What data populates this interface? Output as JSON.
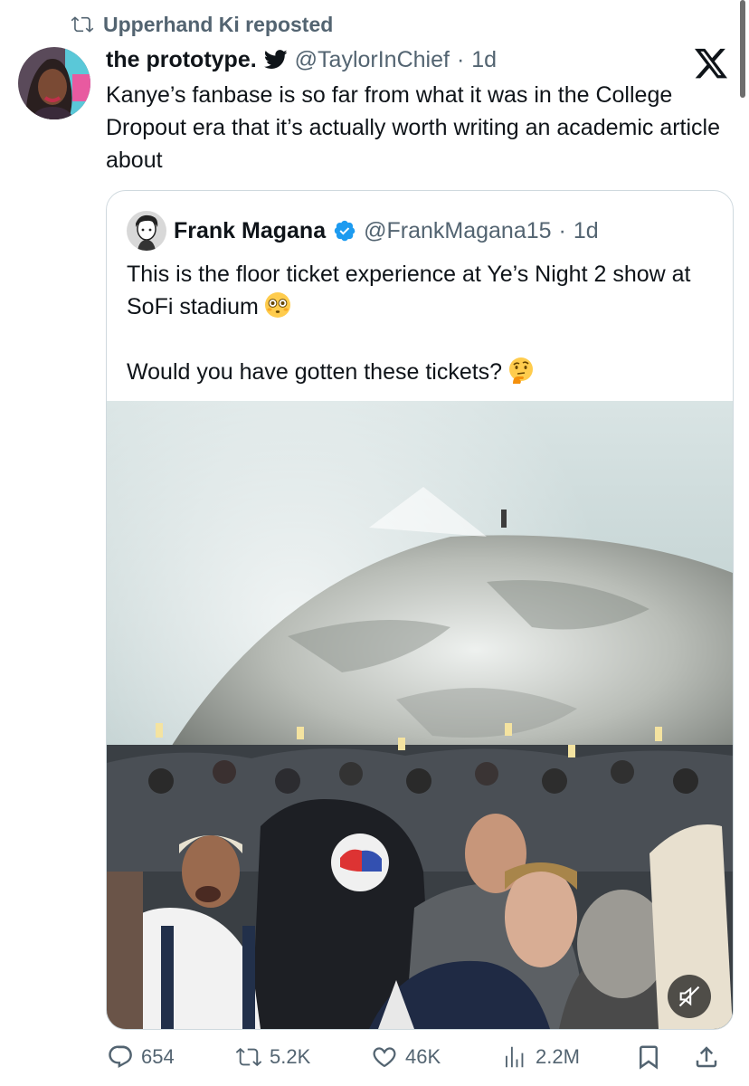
{
  "repost": {
    "icon": "repost-icon",
    "text": "Upperhand Ki reposted"
  },
  "tweet": {
    "display_name": "the prototype.",
    "handle": "@TaylorInChief",
    "separator": "·",
    "time": "1d",
    "text": "Kanye’s fanbase is so far from what it was in the College Dropout era that it’s actually worth writing an academic article about"
  },
  "quote": {
    "display_name": "Frank Magana",
    "handle": "@FrankMagana15",
    "separator": "·",
    "time": "1d",
    "line1": "This is the floor ticket experience at Ye’s Night 2 show at SoFi stadium",
    "line2": "Would you have gotten these tickets?",
    "emoji1": "flushed-face-emoji",
    "emoji2": "thinking-face-emoji"
  },
  "actions": {
    "replies": "654",
    "reposts": "5.2K",
    "likes": "46K",
    "views": "2.2M"
  },
  "colors": {
    "text": "#0f1419",
    "muted": "#536471",
    "border": "#cfd9de",
    "verified": "#1d9bf0"
  }
}
